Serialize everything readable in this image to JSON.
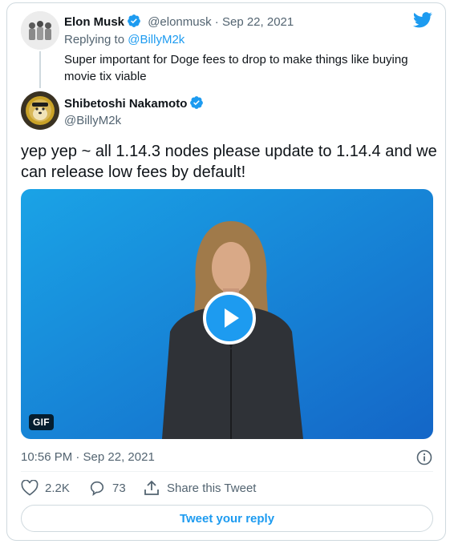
{
  "quoted": {
    "name": "Elon Musk",
    "handle": "@elonmusk",
    "separator": "·",
    "date": "Sep 22, 2021",
    "replying_prefix": "Replying to",
    "replying_to": "@BillyM2k",
    "text": "Super important for Doge fees to drop to make things like buying movie tix viable"
  },
  "main": {
    "name": "Shibetoshi Nakamoto",
    "handle": "@BillyM2k",
    "text": "yep yep ~ all 1.14.3 nodes please update to 1.14.4 and we can release low fees by default!",
    "media_badge": "GIF",
    "timestamp": "10:56 PM · Sep 22, 2021"
  },
  "actions": {
    "likes": "2.2K",
    "replies": "73",
    "share_label": "Share this Tweet",
    "reply_button": "Tweet your reply"
  },
  "colors": {
    "accent": "#1d9bf0",
    "muted": "#536471",
    "border": "#cfd9de"
  },
  "icons": [
    "twitter-bird-icon",
    "verified-badge-icon",
    "play-icon",
    "info-icon",
    "heart-icon",
    "reply-icon",
    "share-icon"
  ]
}
